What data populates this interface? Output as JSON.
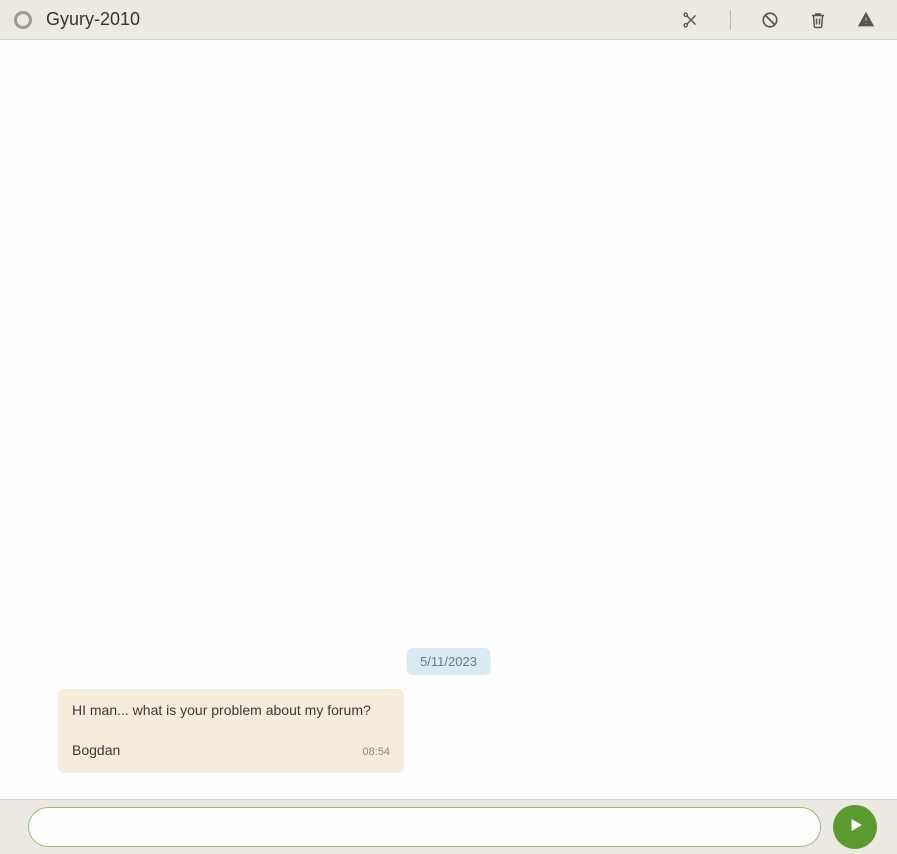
{
  "header": {
    "contact_name": "Gyury-2010"
  },
  "chat": {
    "date_separator": "5/11/2023",
    "messages": [
      {
        "text": "HI man... what is your problem about my forum?",
        "sender": "Bogdan",
        "time": "08:54"
      }
    ]
  },
  "composer": {
    "placeholder": "",
    "value": ""
  }
}
